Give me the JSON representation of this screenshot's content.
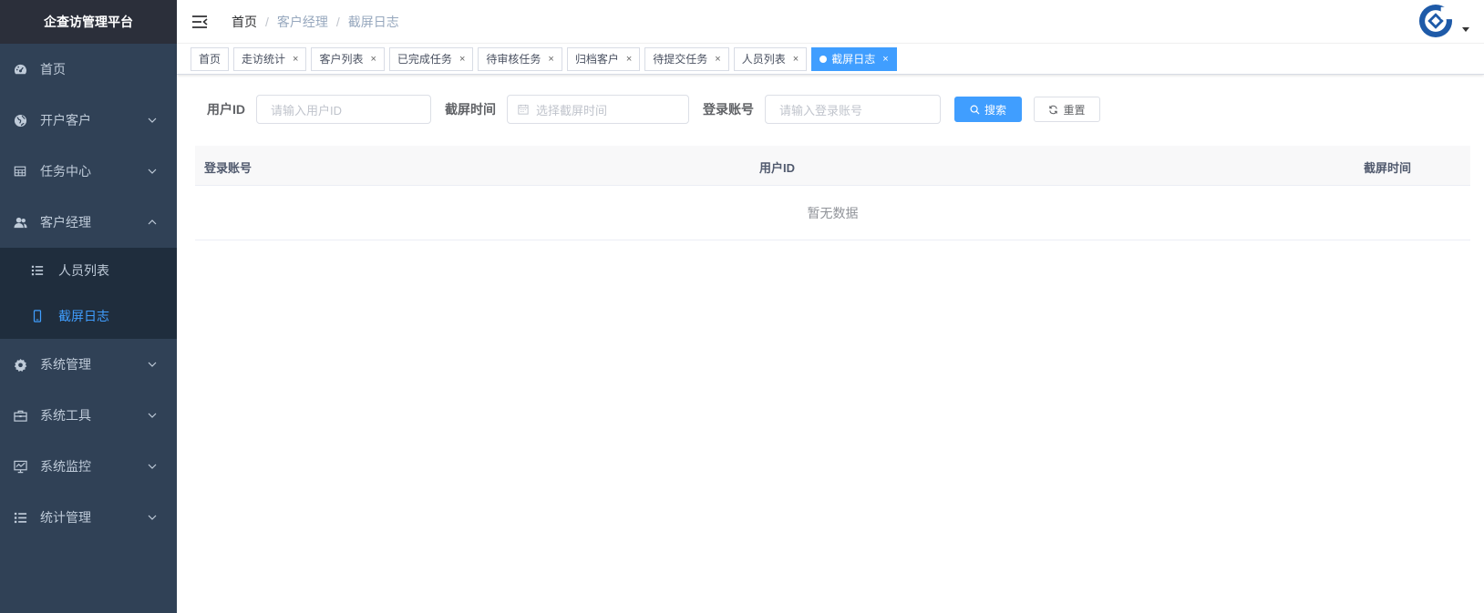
{
  "app": {
    "title": "企查访管理平台"
  },
  "sidebar": {
    "items": [
      {
        "label": "首页",
        "icon": "dashboard-icon"
      },
      {
        "label": "开户客户",
        "icon": "globe-icon"
      },
      {
        "label": "任务中心",
        "icon": "table-icon"
      },
      {
        "label": "客户经理",
        "icon": "people-icon"
      },
      {
        "label": "系统管理",
        "icon": "gear-icon"
      },
      {
        "label": "系统工具",
        "icon": "toolbox-icon"
      },
      {
        "label": "系统监控",
        "icon": "monitor-icon"
      },
      {
        "label": "统计管理",
        "icon": "list-icon"
      }
    ],
    "sub_items": [
      {
        "label": "人员列表",
        "icon": "list-icon"
      },
      {
        "label": "截屏日志",
        "icon": "phone-icon"
      }
    ],
    "active_color": "#409eff"
  },
  "breadcrumb": [
    "首页",
    "客户经理",
    "截屏日志"
  ],
  "tags": [
    {
      "label": "首页"
    },
    {
      "label": "走访统计"
    },
    {
      "label": "客户列表"
    },
    {
      "label": "已完成任务"
    },
    {
      "label": "待审核任务"
    },
    {
      "label": "归档客户"
    },
    {
      "label": "待提交任务"
    },
    {
      "label": "人员列表"
    },
    {
      "label": "截屏日志"
    }
  ],
  "tag_close": "×",
  "filters": {
    "user_id_label": "用户ID",
    "user_id_placeholder": "请输入用户ID",
    "time_label": "截屏时间",
    "time_placeholder": "选择截屏时间",
    "account_label": "登录账号",
    "account_placeholder": "请输入登录账号",
    "search_button": "搜索",
    "reset_button": "重置"
  },
  "table": {
    "columns": [
      "登录账号",
      "用户ID",
      "截屏时间"
    ],
    "empty_text": "暂无数据"
  }
}
